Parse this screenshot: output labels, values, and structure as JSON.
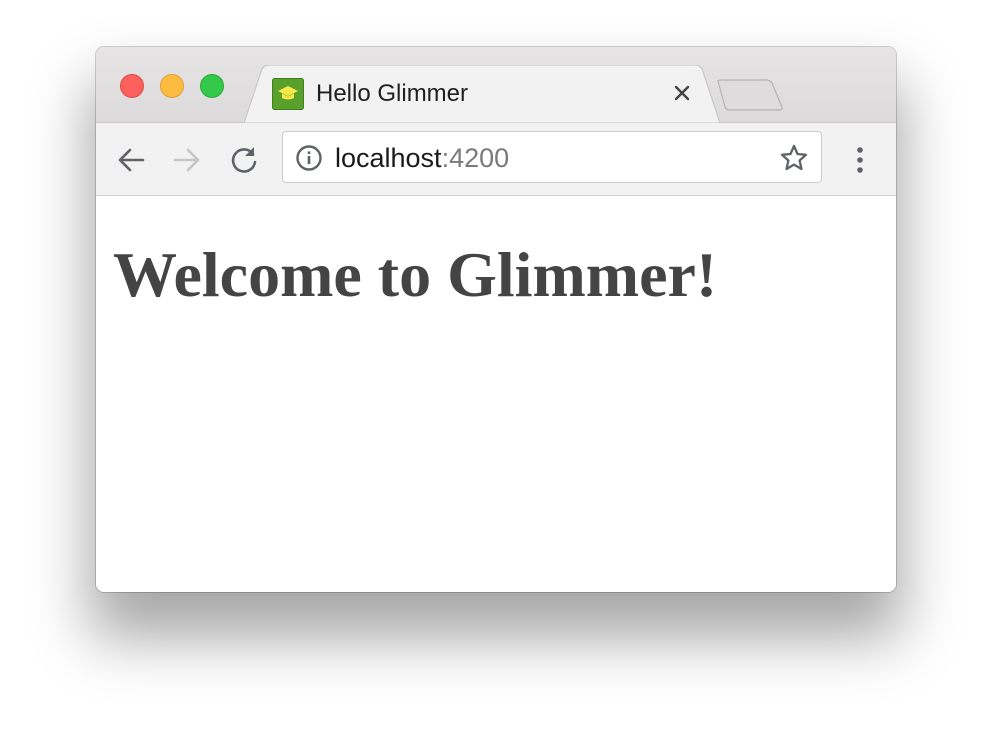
{
  "browser": {
    "tab": {
      "title": "Hello Glimmer",
      "favicon": "graduation-cap-icon",
      "favicon_color": "#5aa02c"
    },
    "address_bar": {
      "host": "localhost",
      "port": ":4200"
    },
    "toolbar_icons": [
      "back-arrow-icon",
      "forward-arrow-icon",
      "reload-icon",
      "info-icon",
      "star-icon",
      "menu-dots-icon"
    ]
  },
  "page": {
    "heading": "Welcome to Glimmer!",
    "heading_color": "#444444"
  }
}
